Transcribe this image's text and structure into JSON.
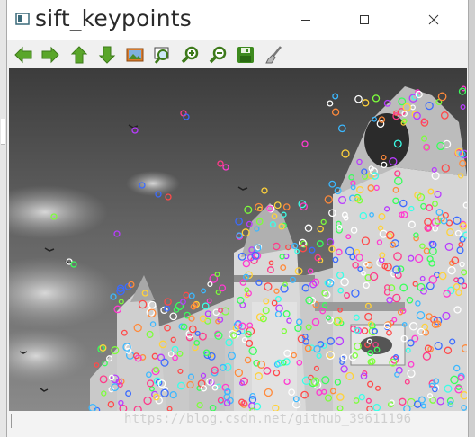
{
  "window": {
    "title": "sift_keypoints"
  },
  "toolbar": {
    "buttons": [
      {
        "name": "pan-left",
        "icon": "arrow-left-icon"
      },
      {
        "name": "pan-right",
        "icon": "arrow-right-icon"
      },
      {
        "name": "pan-up",
        "icon": "arrow-up-icon"
      },
      {
        "name": "pan-down",
        "icon": "arrow-down-icon"
      },
      {
        "name": "zoom-fit",
        "icon": "image-icon"
      },
      {
        "name": "zoom-actual",
        "icon": "zoom-area-icon"
      },
      {
        "name": "zoom-in",
        "icon": "zoom-in-icon"
      },
      {
        "name": "zoom-out",
        "icon": "zoom-out-icon"
      },
      {
        "name": "save",
        "icon": "floppy-disk-icon"
      },
      {
        "name": "properties",
        "icon": "brush-icon"
      }
    ]
  },
  "statusbar": {
    "text": ""
  },
  "watermark": "https://blog.csdn.net/github_39611196",
  "colors": {
    "toolbar_green": "#5aa62a",
    "title_text": "#2a2a2a"
  }
}
